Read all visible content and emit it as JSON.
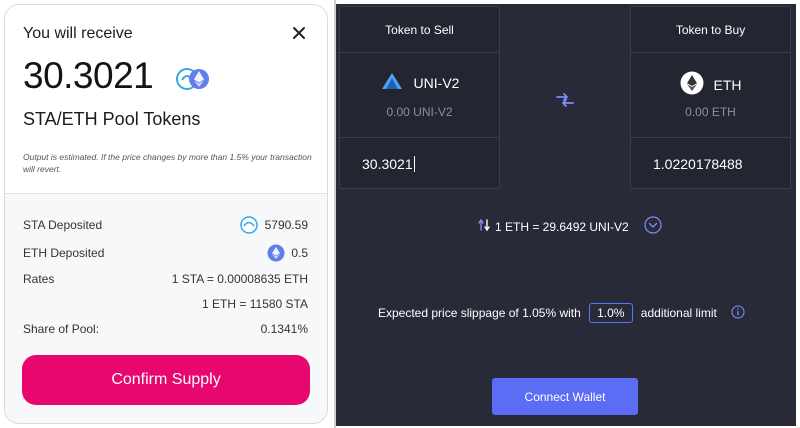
{
  "modal": {
    "title": "You will receive",
    "amount": "30.3021",
    "pool_label": "STA/ETH Pool Tokens",
    "note": "Output is estimated. If the price changes by more than 1.5% your transaction will revert.",
    "rows": [
      {
        "label": "STA Deposited",
        "value": "5790.59",
        "icon": "sta-token-icon"
      },
      {
        "label": "ETH Deposited",
        "value": "0.5",
        "icon": "eth-token-icon"
      },
      {
        "label": "Rates",
        "value": "1 STA = 0.00008635 ETH"
      },
      {
        "label": "",
        "value": "1 ETH = 11580 STA"
      },
      {
        "label": "Share of Pool:",
        "value": "0.1341%"
      }
    ],
    "confirm_label": "Confirm Supply",
    "accent": "#e8076e"
  },
  "exchange": {
    "sell": {
      "header": "Token to Sell",
      "token": "UNI-V2",
      "balance": "0.00 UNI-V2",
      "amount": "30.3021"
    },
    "buy": {
      "header": "Token to Buy",
      "token": "ETH",
      "balance": "0.00 ETH",
      "amount": "1.0220178488"
    },
    "rate": "1 ETH = 29.6492 UNI-V2",
    "slippage_prefix": "Expected price slippage of 1.05% with",
    "slippage_limit": "1.0%",
    "slippage_suffix": "additional limit",
    "connect_label": "Connect Wallet",
    "accent": "#5b6cf5",
    "background": "#282a37"
  }
}
